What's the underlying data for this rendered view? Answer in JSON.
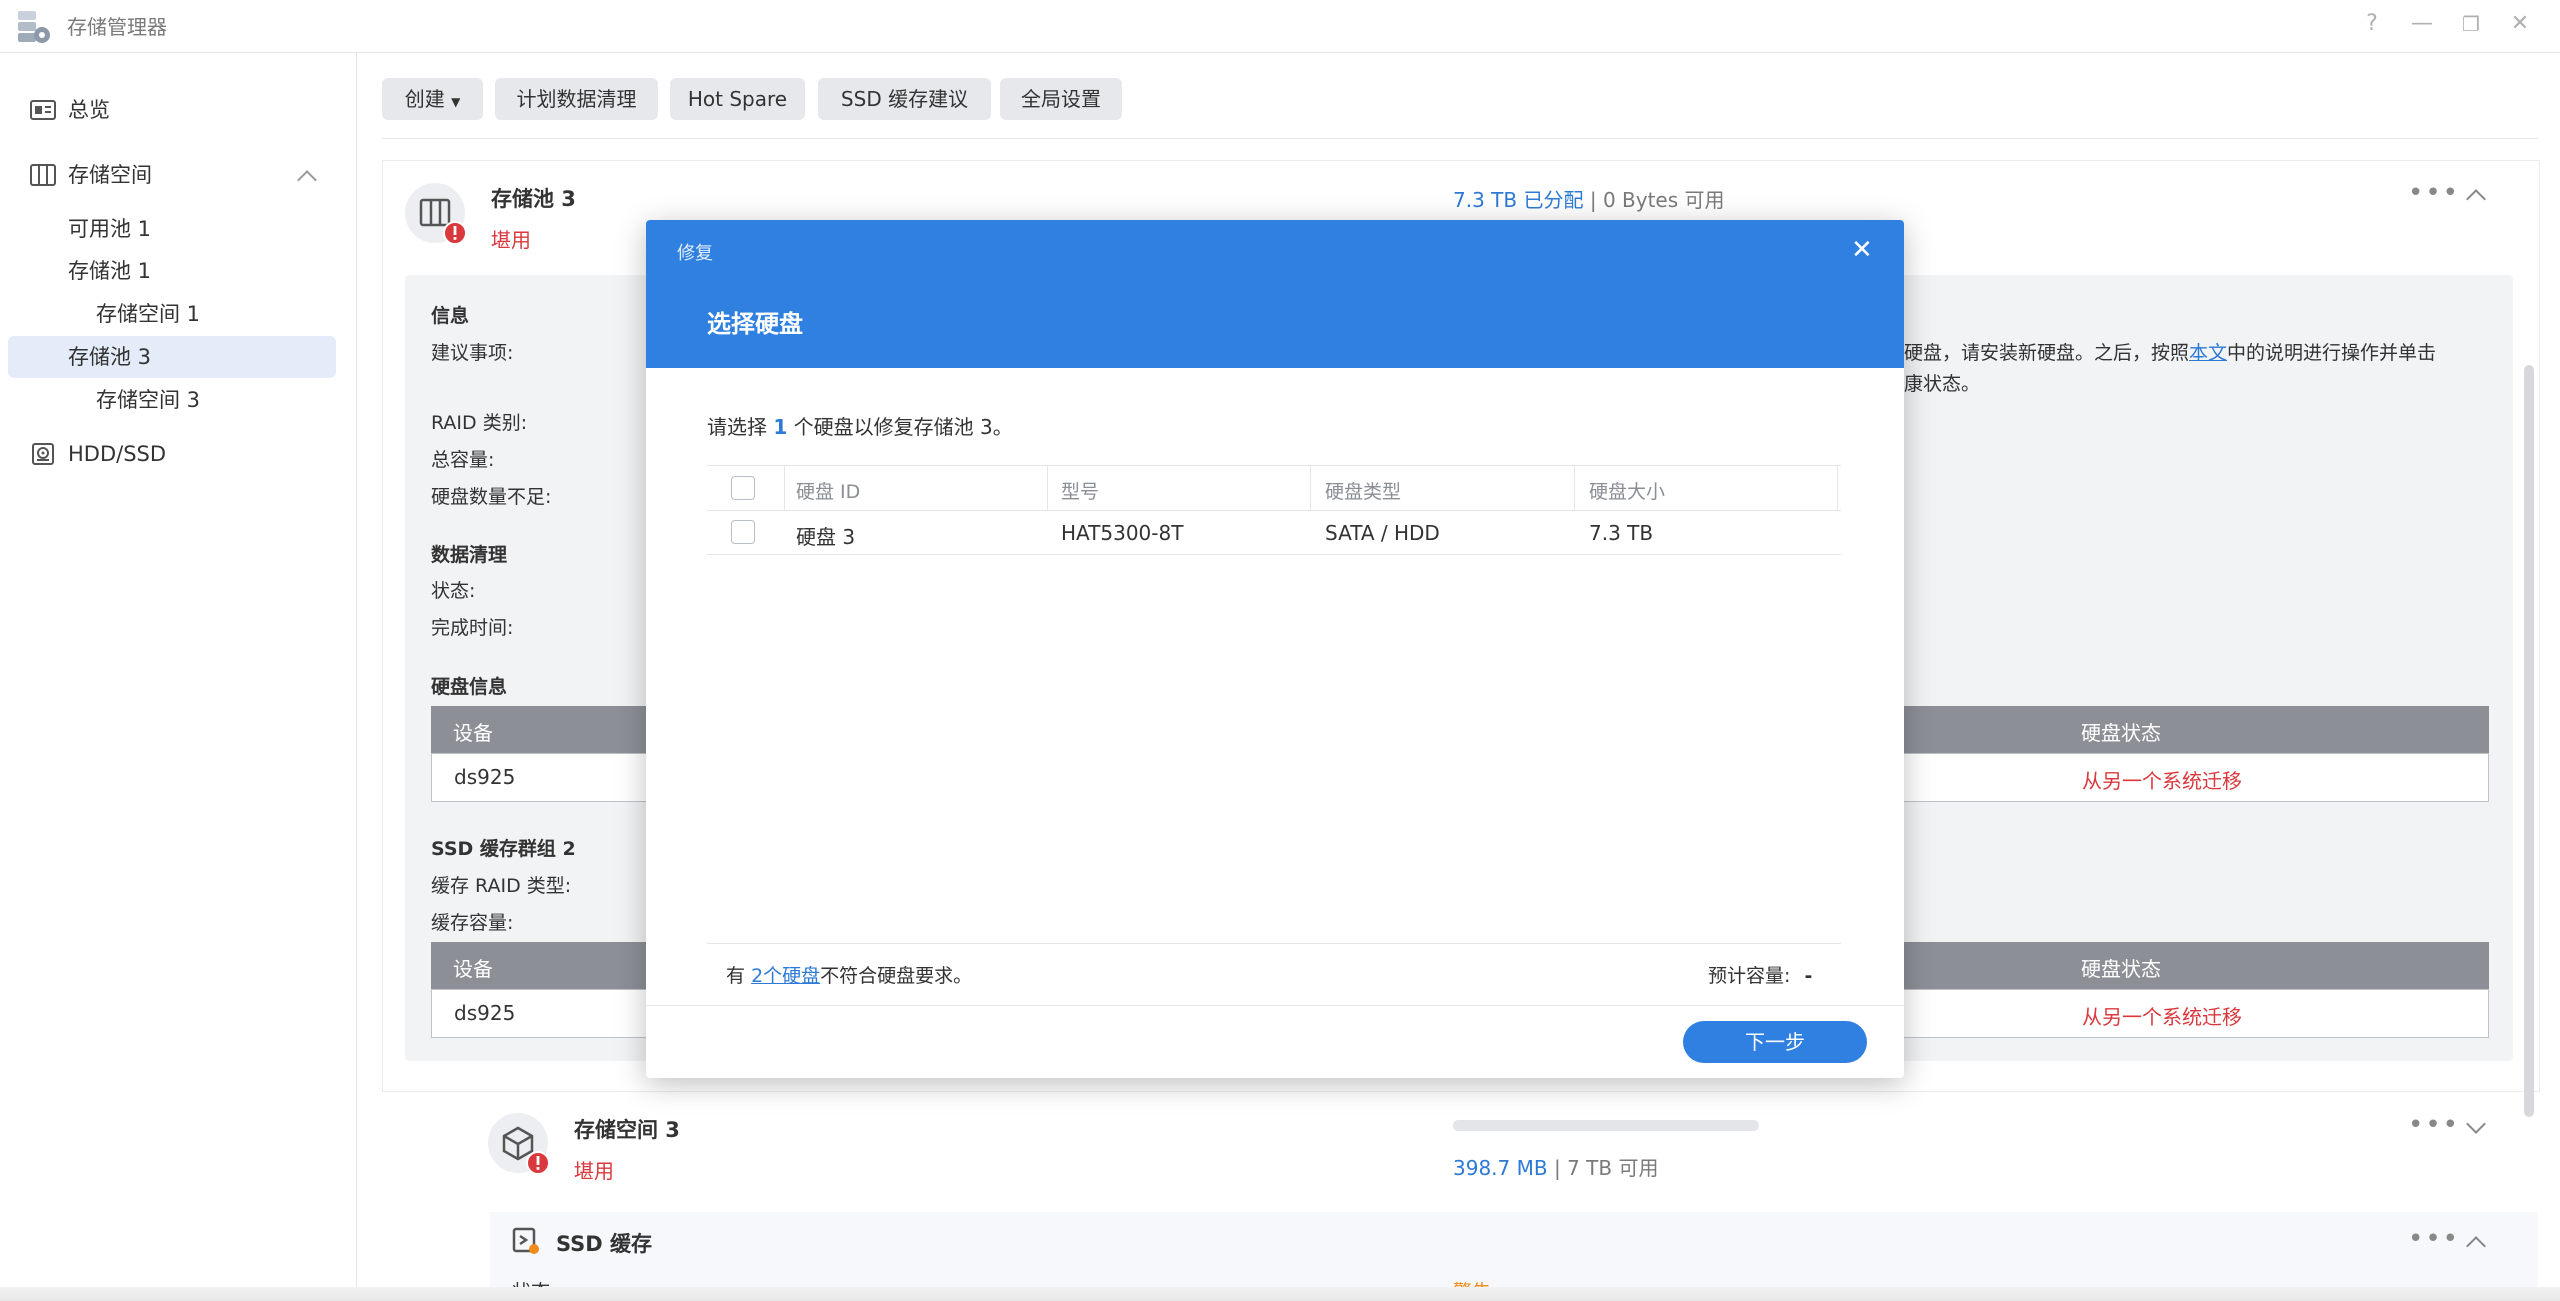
{
  "window": {
    "title": "存储管理器",
    "help": "?",
    "minimize": "—",
    "restore": "❐",
    "close": "✕"
  },
  "sidebar": {
    "overview": "总览",
    "storage": "存储空间",
    "items": [
      "可用池 1",
      "存储池 1",
      "存储空间 1",
      "存储池 3",
      "存储空间 3"
    ],
    "hdd": "HDD/SSD"
  },
  "toolbar": {
    "create": "创建",
    "scrub": "计划数据清理",
    "hotspare": "Hot Spare",
    "ssd_advice": "SSD 缓存建议",
    "global": "全局设置"
  },
  "pool": {
    "name": "存储池 3",
    "status": "堪用",
    "allocated": "7.3 TB 已分配",
    "sep": "|",
    "available": "0 Bytes 可用",
    "info_title": "信息",
    "suggest_label": "建议事项:",
    "suggest_text1": "硬盘，请安装新硬盘。之后，按照",
    "suggest_link": "本文",
    "suggest_text2": "中的说明进行操作并单击",
    "suggest_text3": "康状态。",
    "raid_label": "RAID 类别:",
    "capacity_label": "总容量:",
    "insufficient_label": "硬盘数量不足:",
    "scrub_title": "数据清理",
    "scrub_status": "状态:",
    "scrub_done": "完成时间:",
    "disk_info_title": "硬盘信息",
    "table_device": "设备",
    "table_status": "硬盘状态",
    "device_name": "ds925",
    "disk_status": "从另一个系统迁移",
    "ssd_group_title": "SSD 缓存群组 2",
    "cache_raid": "缓存 RAID 类型:",
    "cache_capacity": "缓存容量:"
  },
  "volume": {
    "name": "存储空间 3",
    "status": "堪用",
    "used": "398.7 MB",
    "sep": "|",
    "free": "7 TB 可用",
    "usage_fraction": 0.0
  },
  "ssd_cache": {
    "title": "SSD 缓存",
    "partial_left": "状态",
    "partial_right": "警告"
  },
  "dialog": {
    "header_small": "修复",
    "header_title": "选择硬盘",
    "prompt_pre": "请选择",
    "prompt_count": "1",
    "prompt_post": "个硬盘以修复存储池 3。",
    "columns": [
      "硬盘 ID",
      "型号",
      "硬盘类型",
      "硬盘大小"
    ],
    "rows": [
      {
        "id": "硬盘 3",
        "model": "HAT5300-8T",
        "type": "SATA / HDD",
        "size": "7.3 TB"
      }
    ],
    "footer_pre": "有",
    "footer_link": "2个硬盘",
    "footer_post": "不符合硬盘要求。",
    "estimate_label": "预计容量:",
    "estimate_value": "-",
    "next": "下一步"
  },
  "colors": {
    "accent": "#2f80e0",
    "danger": "#d9393d",
    "link": "#2d7ad6"
  }
}
